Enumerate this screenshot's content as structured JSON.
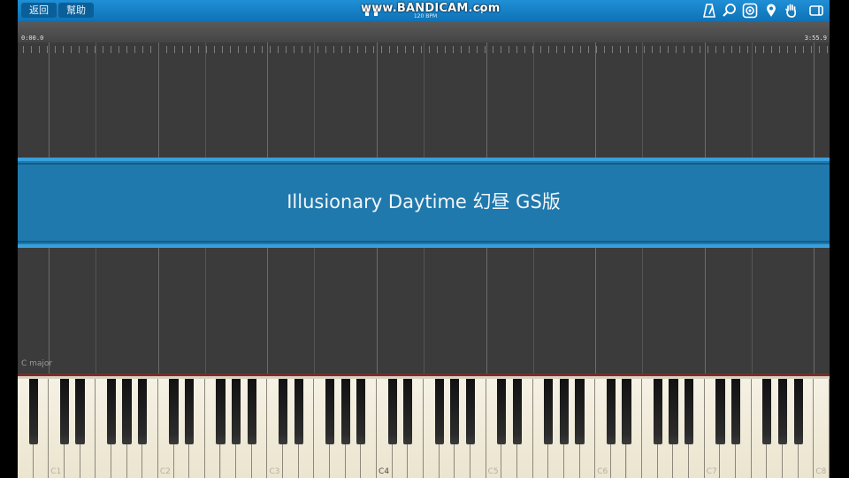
{
  "toolbar": {
    "back_label": "返回",
    "help_label": "幫助",
    "watermark": "www.BANDICAM.com",
    "tempo": "120 BPM",
    "icons": [
      "metronome-icon",
      "search-icon",
      "settings-icon",
      "location-icon",
      "hand-icon",
      "window-icon"
    ]
  },
  "timeline": {
    "start_time": "0:00.0",
    "end_time": "3:55.9"
  },
  "title_banner": {
    "title": "Illusionary Daytime 幻昼 GS版"
  },
  "key_signature": "C major",
  "keyboard": {
    "octave_labels": [
      "C1",
      "C2",
      "C3",
      "C4",
      "C5",
      "C6",
      "C7",
      "C8"
    ],
    "highlighted_label": "C4"
  },
  "colors": {
    "toolbar": "#1280c7",
    "banner": "#2079ad",
    "background": "#3b3b3b",
    "keyboard_top_border": "#7a2d2d"
  }
}
